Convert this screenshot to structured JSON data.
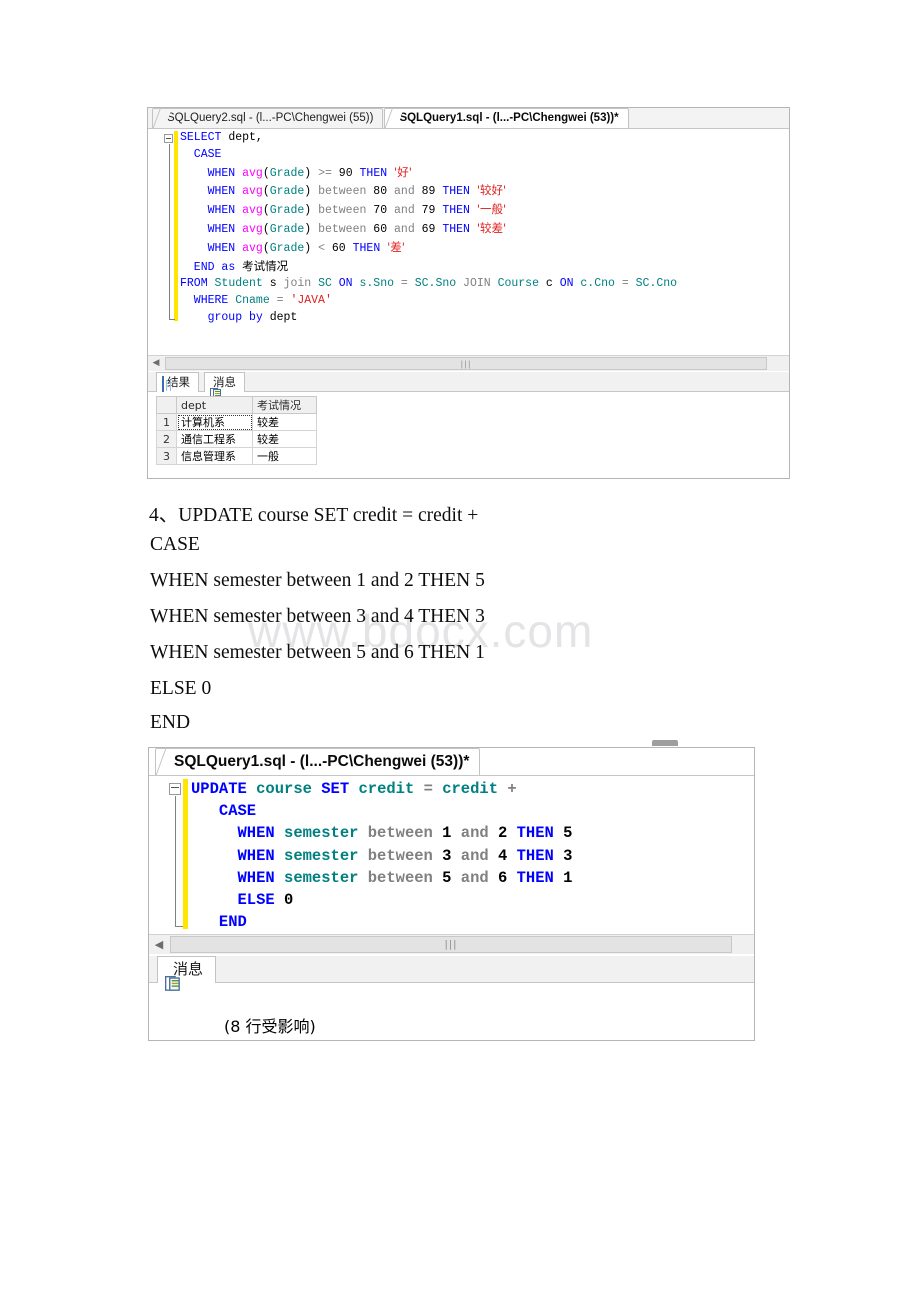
{
  "document": {
    "watermark": "www.bdocx.com",
    "paragraphs": [
      "4、UPDATE course SET credit = credit +",
      "CASE",
      "WHEN semester between 1 and 2 THEN 5",
      "WHEN semester between 3 and 4 THEN 3",
      "WHEN semester between 5 and 6 THEN 1",
      "ELSE 0",
      "END"
    ]
  },
  "colors": {
    "keyword": "#0000ff",
    "identifier": "#008080",
    "function": "#ff00ff",
    "string": "#e02020",
    "operator_gray": "#808080",
    "changebar_yellow": "#ffe500",
    "tabstrip_bg": "#f3f3f3"
  },
  "window1": {
    "tabs": [
      {
        "label": "SQLQuery2.sql - (l...-PC\\Chengwei (55))",
        "active": false
      },
      {
        "label": "SQLQuery1.sql - (l...-PC\\Chengwei (53))*",
        "active": true
      }
    ],
    "editor": {
      "lines": [
        [
          {
            "t": "SELECT ",
            "c": "kw"
          },
          {
            "t": "dept,",
            "c": "plain"
          }
        ],
        [
          {
            "t": "  CASE",
            "c": "kw"
          }
        ],
        [
          {
            "t": "    WHEN ",
            "c": "kw"
          },
          {
            "t": "avg",
            "c": "fn"
          },
          {
            "t": "(",
            "c": "plain"
          },
          {
            "t": "Grade",
            "c": "id"
          },
          {
            "t": ") ",
            "c": "plain"
          },
          {
            "t": ">= ",
            "c": "gray"
          },
          {
            "t": "90 ",
            "c": "num"
          },
          {
            "t": "THEN ",
            "c": "kw"
          },
          {
            "t": "'好'",
            "c": "cjk-red"
          }
        ],
        [
          {
            "t": "    WHEN ",
            "c": "kw"
          },
          {
            "t": "avg",
            "c": "fn"
          },
          {
            "t": "(",
            "c": "plain"
          },
          {
            "t": "Grade",
            "c": "id"
          },
          {
            "t": ") ",
            "c": "plain"
          },
          {
            "t": "between ",
            "c": "gray"
          },
          {
            "t": "80 ",
            "c": "num"
          },
          {
            "t": "and ",
            "c": "gray"
          },
          {
            "t": "89 ",
            "c": "num"
          },
          {
            "t": "THEN ",
            "c": "kw"
          },
          {
            "t": "'较好'",
            "c": "cjk-red"
          }
        ],
        [
          {
            "t": "    WHEN ",
            "c": "kw"
          },
          {
            "t": "avg",
            "c": "fn"
          },
          {
            "t": "(",
            "c": "plain"
          },
          {
            "t": "Grade",
            "c": "id"
          },
          {
            "t": ") ",
            "c": "plain"
          },
          {
            "t": "between ",
            "c": "gray"
          },
          {
            "t": "70 ",
            "c": "num"
          },
          {
            "t": "and ",
            "c": "gray"
          },
          {
            "t": "79 ",
            "c": "num"
          },
          {
            "t": "THEN ",
            "c": "kw"
          },
          {
            "t": "'一般'",
            "c": "cjk-red"
          }
        ],
        [
          {
            "t": "    WHEN ",
            "c": "kw"
          },
          {
            "t": "avg",
            "c": "fn"
          },
          {
            "t": "(",
            "c": "plain"
          },
          {
            "t": "Grade",
            "c": "id"
          },
          {
            "t": ") ",
            "c": "plain"
          },
          {
            "t": "between ",
            "c": "gray"
          },
          {
            "t": "60 ",
            "c": "num"
          },
          {
            "t": "and ",
            "c": "gray"
          },
          {
            "t": "69 ",
            "c": "num"
          },
          {
            "t": "THEN ",
            "c": "kw"
          },
          {
            "t": "'较差'",
            "c": "cjk-red"
          }
        ],
        [
          {
            "t": "    WHEN ",
            "c": "kw"
          },
          {
            "t": "avg",
            "c": "fn"
          },
          {
            "t": "(",
            "c": "plain"
          },
          {
            "t": "Grade",
            "c": "id"
          },
          {
            "t": ") ",
            "c": "plain"
          },
          {
            "t": "< ",
            "c": "gray"
          },
          {
            "t": "60 ",
            "c": "num"
          },
          {
            "t": "THEN ",
            "c": "kw"
          },
          {
            "t": "'差'",
            "c": "cjk-red"
          }
        ],
        [
          {
            "t": "  END ",
            "c": "kw"
          },
          {
            "t": "as ",
            "c": "kw"
          },
          {
            "t": "考试情况",
            "c": "cjk"
          }
        ],
        [
          {
            "t": "FROM ",
            "c": "kw"
          },
          {
            "t": "Student ",
            "c": "id"
          },
          {
            "t": "s ",
            "c": "plain"
          },
          {
            "t": "join ",
            "c": "gray"
          },
          {
            "t": "SC ",
            "c": "id"
          },
          {
            "t": "ON ",
            "c": "kw"
          },
          {
            "t": "s.Sno ",
            "c": "id"
          },
          {
            "t": "= ",
            "c": "gray"
          },
          {
            "t": "SC.Sno ",
            "c": "id"
          },
          {
            "t": "JOIN ",
            "c": "gray"
          },
          {
            "t": "Course ",
            "c": "id"
          },
          {
            "t": "c ",
            "c": "plain"
          },
          {
            "t": "ON ",
            "c": "kw"
          },
          {
            "t": "c.Cno ",
            "c": "id"
          },
          {
            "t": "= ",
            "c": "gray"
          },
          {
            "t": "SC.Cno",
            "c": "id"
          }
        ],
        [
          {
            "t": "  WHERE ",
            "c": "kw"
          },
          {
            "t": "Cname ",
            "c": "id"
          },
          {
            "t": "= ",
            "c": "gray"
          },
          {
            "t": "'JAVA'",
            "c": "str"
          }
        ],
        [
          {
            "t": "    group by ",
            "c": "kw"
          },
          {
            "t": "dept",
            "c": "plain"
          }
        ]
      ]
    },
    "results": {
      "tabs": [
        {
          "label": "结果",
          "icon": "grid-icon",
          "active": true
        },
        {
          "label": "消息",
          "icon": "message-icon",
          "active": false
        }
      ],
      "grid": {
        "columns": [
          "",
          "dept",
          "考试情况"
        ],
        "rows": [
          {
            "num": "1",
            "dept": "计算机系",
            "status": "较差",
            "selected": true
          },
          {
            "num": "2",
            "dept": "通信工程系",
            "status": "较差",
            "selected": false
          },
          {
            "num": "3",
            "dept": "信息管理系",
            "status": "一般",
            "selected": false
          }
        ]
      }
    },
    "scrollbar": {
      "grip": "|||",
      "left_arrow": "◀"
    }
  },
  "window2": {
    "tabs": [
      {
        "label": "SQLQuery1.sql - (l...-PC\\Chengwei (53))*",
        "active": true
      }
    ],
    "editor": {
      "lines": [
        [
          {
            "t": "UPDATE ",
            "c": "kw"
          },
          {
            "t": "course ",
            "c": "id"
          },
          {
            "t": "SET ",
            "c": "kw"
          },
          {
            "t": "credit ",
            "c": "id"
          },
          {
            "t": "= ",
            "c": "gray"
          },
          {
            "t": "credit ",
            "c": "id"
          },
          {
            "t": "+",
            "c": "gray"
          }
        ],
        [
          {
            "t": "   CASE",
            "c": "kw"
          }
        ],
        [
          {
            "t": "     WHEN ",
            "c": "kw"
          },
          {
            "t": "semester ",
            "c": "id"
          },
          {
            "t": "between ",
            "c": "gray"
          },
          {
            "t": "1 ",
            "c": "num"
          },
          {
            "t": "and ",
            "c": "gray"
          },
          {
            "t": "2 ",
            "c": "num"
          },
          {
            "t": "THEN ",
            "c": "kw"
          },
          {
            "t": "5",
            "c": "num"
          }
        ],
        [
          {
            "t": "     WHEN ",
            "c": "kw"
          },
          {
            "t": "semester ",
            "c": "id"
          },
          {
            "t": "between ",
            "c": "gray"
          },
          {
            "t": "3 ",
            "c": "num"
          },
          {
            "t": "and ",
            "c": "gray"
          },
          {
            "t": "4 ",
            "c": "num"
          },
          {
            "t": "THEN ",
            "c": "kw"
          },
          {
            "t": "3",
            "c": "num"
          }
        ],
        [
          {
            "t": "     WHEN ",
            "c": "kw"
          },
          {
            "t": "semester ",
            "c": "id"
          },
          {
            "t": "between ",
            "c": "gray"
          },
          {
            "t": "5 ",
            "c": "num"
          },
          {
            "t": "and ",
            "c": "gray"
          },
          {
            "t": "6 ",
            "c": "num"
          },
          {
            "t": "THEN ",
            "c": "kw"
          },
          {
            "t": "1",
            "c": "num"
          }
        ],
        [
          {
            "t": "     ELSE ",
            "c": "kw"
          },
          {
            "t": "0",
            "c": "num"
          }
        ],
        [
          {
            "t": "   END",
            "c": "kw"
          }
        ]
      ]
    },
    "results": {
      "tabs": [
        {
          "label": "消息",
          "icon": "message-icon",
          "active": true
        }
      ],
      "message": "(8 行受影响)"
    },
    "scrollbar": {
      "grip": "|||",
      "left_arrow": "◀"
    }
  }
}
